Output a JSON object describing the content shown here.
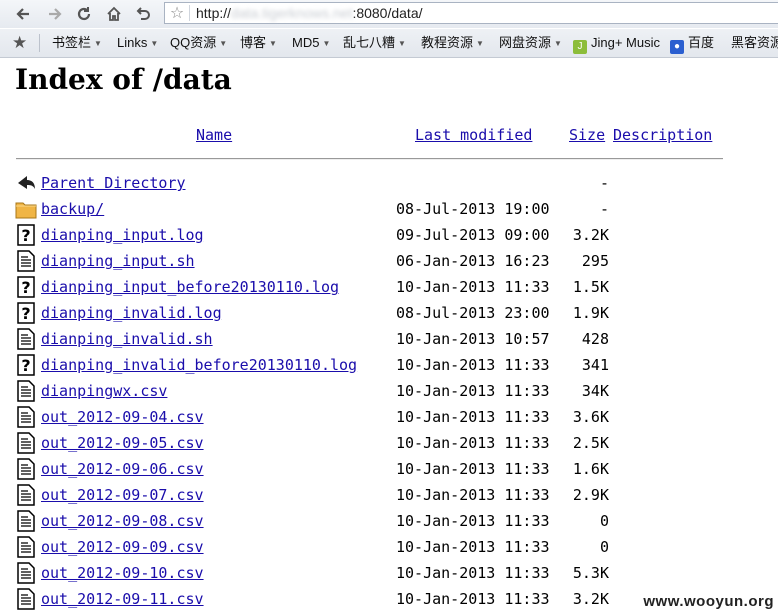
{
  "browser": {
    "url_prefix": "http://",
    "url_blurred_host": "data.tigerknows.net",
    "url_suffix": ":8080/data/"
  },
  "bookmarks": [
    {
      "label": "书签栏",
      "dropdown": true
    },
    {
      "label": "Links",
      "dropdown": true
    },
    {
      "label": "QQ资源",
      "dropdown": true
    },
    {
      "label": "博客",
      "dropdown": true
    },
    {
      "label": "MD5",
      "dropdown": true
    },
    {
      "label": "乱七八糟",
      "dropdown": true
    },
    {
      "label": "教程资源",
      "dropdown": true
    },
    {
      "label": "网盘资源",
      "dropdown": true
    },
    {
      "label": "Jing+ Music",
      "icon": "J"
    },
    {
      "label": "百度",
      "icon": "paw"
    },
    {
      "label": "黑客资源"
    }
  ],
  "page": {
    "title": "Index of /data",
    "columns": {
      "name": "Name",
      "last_modified": "Last modified",
      "size": "Size",
      "description": "Description"
    },
    "rows": [
      {
        "icon": "back-icon",
        "name": "Parent Directory",
        "modified": "",
        "size": "-"
      },
      {
        "icon": "folder-icon",
        "name": "backup/",
        "modified": "08-Jul-2013 19:00",
        "size": "-"
      },
      {
        "icon": "unknown-file-icon",
        "name": "dianping_input.log",
        "modified": "09-Jul-2013 09:00",
        "size": "3.2K"
      },
      {
        "icon": "text-file-icon",
        "name": "dianping_input.sh",
        "modified": "06-Jan-2013 16:23",
        "size": "295"
      },
      {
        "icon": "unknown-file-icon",
        "name": "dianping_input_before20130110.log",
        "modified": "10-Jan-2013 11:33",
        "size": "1.5K"
      },
      {
        "icon": "unknown-file-icon",
        "name": "dianping_invalid.log",
        "modified": "08-Jul-2013 23:00",
        "size": "1.9K"
      },
      {
        "icon": "text-file-icon",
        "name": "dianping_invalid.sh",
        "modified": "10-Jan-2013 10:57",
        "size": "428"
      },
      {
        "icon": "unknown-file-icon",
        "name": "dianping_invalid_before20130110.log",
        "modified": "10-Jan-2013 11:33",
        "size": "341"
      },
      {
        "icon": "text-file-icon",
        "name": "dianpingwx.csv",
        "modified": "10-Jan-2013 11:33",
        "size": "34K"
      },
      {
        "icon": "text-file-icon",
        "name": "out_2012-09-04.csv",
        "modified": "10-Jan-2013 11:33",
        "size": "3.6K"
      },
      {
        "icon": "text-file-icon",
        "name": "out_2012-09-05.csv",
        "modified": "10-Jan-2013 11:33",
        "size": "2.5K"
      },
      {
        "icon": "text-file-icon",
        "name": "out_2012-09-06.csv",
        "modified": "10-Jan-2013 11:33",
        "size": "1.6K"
      },
      {
        "icon": "text-file-icon",
        "name": "out_2012-09-07.csv",
        "modified": "10-Jan-2013 11:33",
        "size": "2.9K"
      },
      {
        "icon": "text-file-icon",
        "name": "out_2012-09-08.csv",
        "modified": "10-Jan-2013 11:33",
        "size": "0"
      },
      {
        "icon": "text-file-icon",
        "name": "out_2012-09-09.csv",
        "modified": "10-Jan-2013 11:33",
        "size": "0"
      },
      {
        "icon": "text-file-icon",
        "name": "out_2012-09-10.csv",
        "modified": "10-Jan-2013 11:33",
        "size": "5.3K"
      },
      {
        "icon": "text-file-icon",
        "name": "out_2012-09-11.csv",
        "modified": "10-Jan-2013 11:33",
        "size": "3.2K"
      }
    ]
  },
  "watermark": "www.wooyun.org",
  "colors": {
    "link": "#1a0dab",
    "folder": "#f0b545",
    "chrome_bg": "#e6eaf0"
  }
}
